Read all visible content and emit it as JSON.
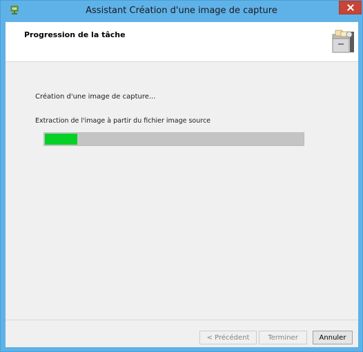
{
  "window": {
    "title": "Assistant Création d'une image de capture"
  },
  "header": {
    "title": "Progression de la tâche",
    "icon": "file-cabinet-icon"
  },
  "body": {
    "status_text": "Création d'une image de capture...",
    "step_text": "Extraction de l'image à partir du fichier image source",
    "progress_fraction": 0.13
  },
  "footer": {
    "prev_label": "< Précédent",
    "finish_label": "Terminer",
    "cancel_label": "Annuler"
  },
  "colors": {
    "titlebar": "#5fb2e8",
    "close_button": "#c74436",
    "progress_fill": "#06d025",
    "progress_track": "#c4c4c4"
  }
}
